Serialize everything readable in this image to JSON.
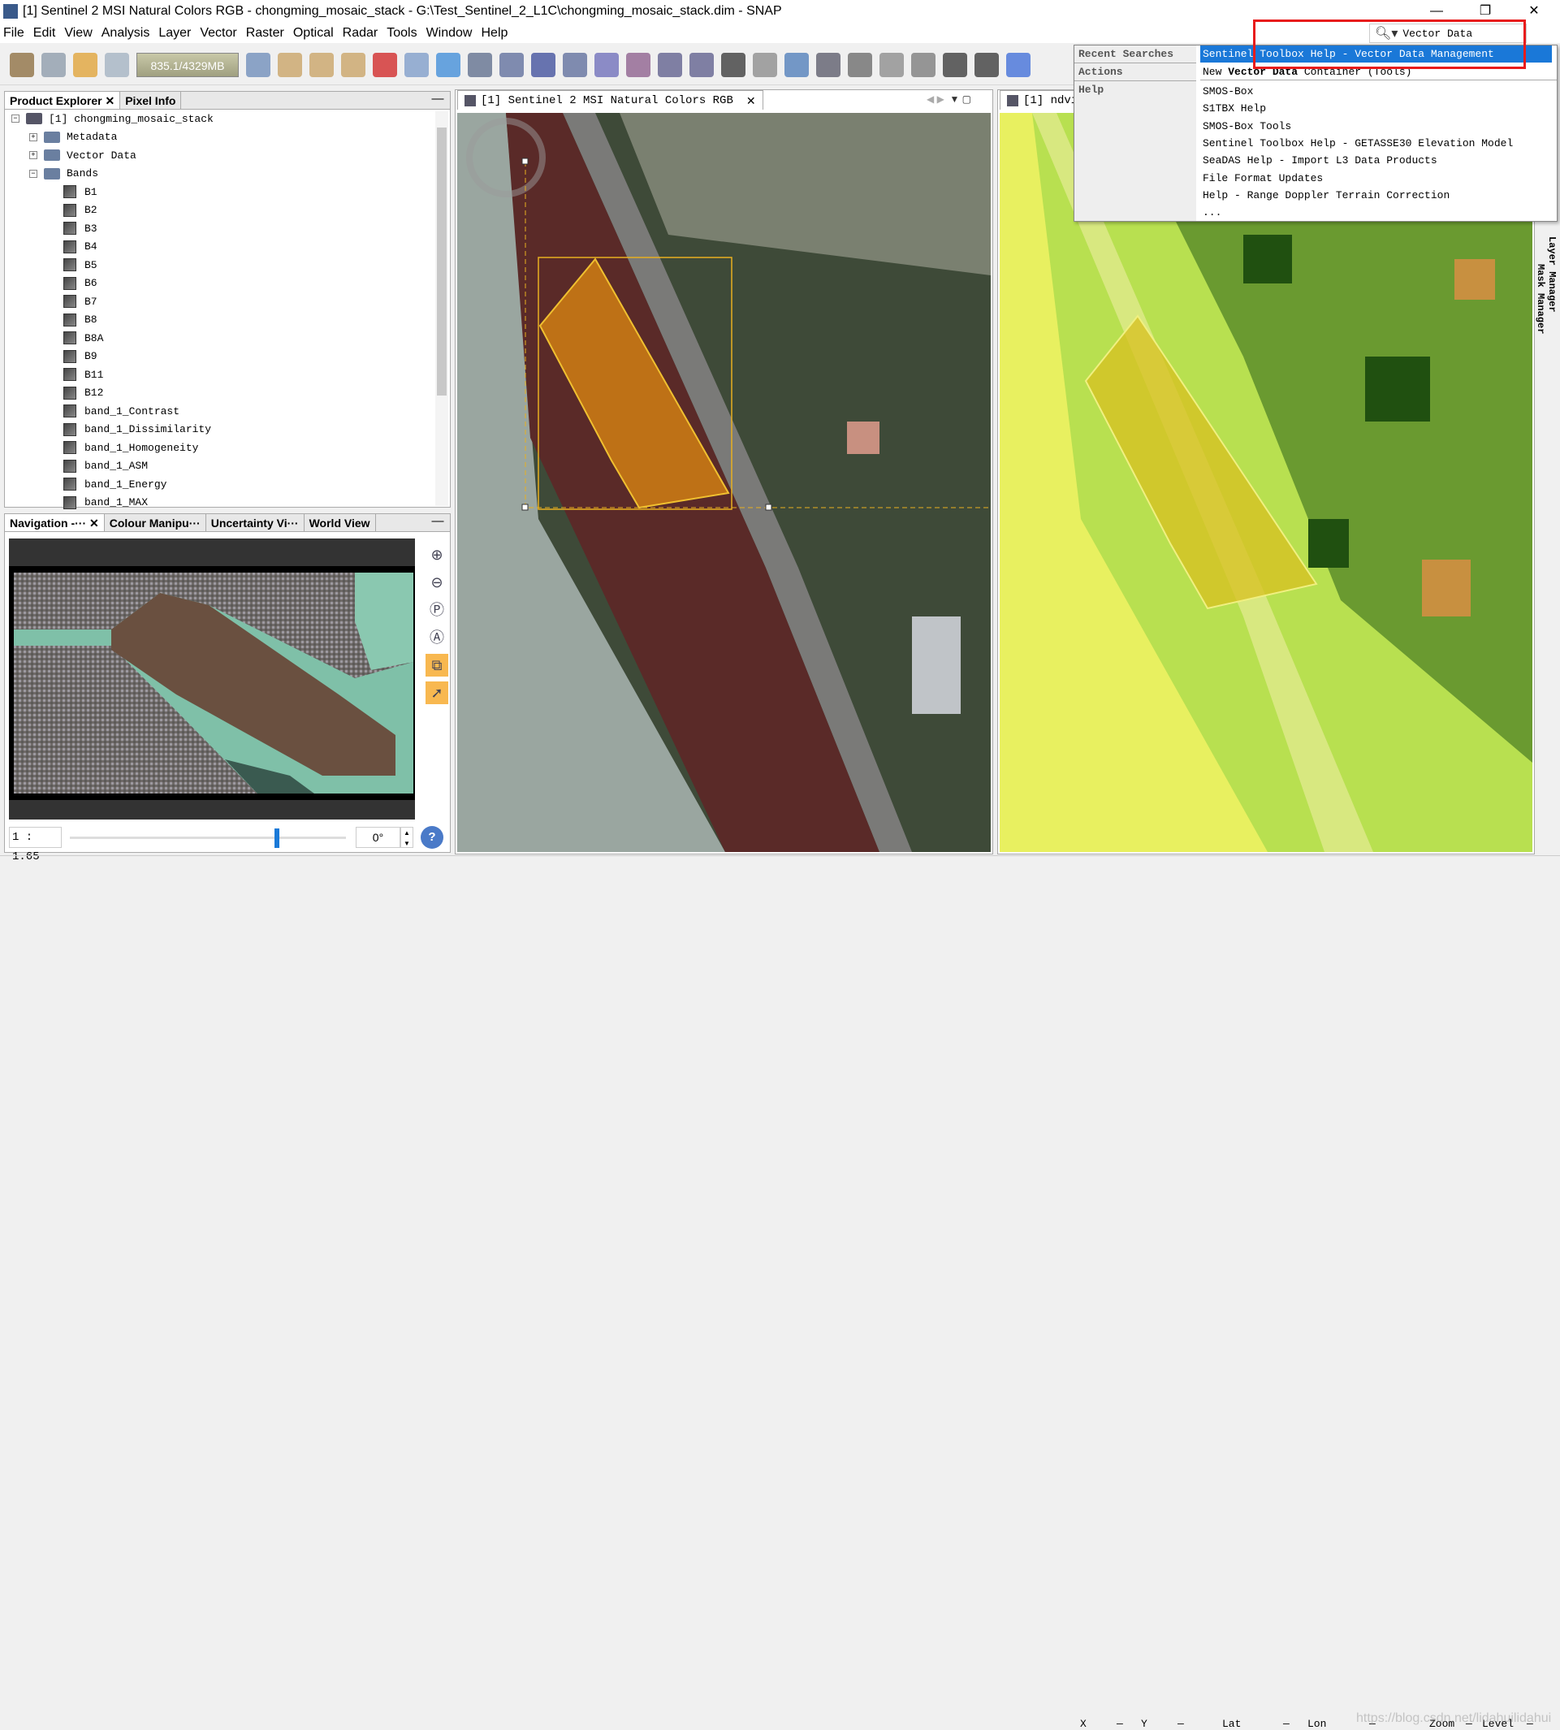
{
  "window": {
    "title": "[1] Sentinel 2 MSI Natural Colors RGB - chongming_mosaic_stack - G:\\Test_Sentinel_2_L1C\\chongming_mosaic_stack.dim - SNAP",
    "minimize": "—",
    "restore": "❐",
    "close": "✕"
  },
  "menu": [
    "File",
    "Edit",
    "View",
    "Analysis",
    "Layer",
    "Vector",
    "Raster",
    "Optical",
    "Radar",
    "Tools",
    "Window",
    "Help"
  ],
  "toolbar": {
    "memory": "835.1/4329MB",
    "icons": [
      "open-product-icon",
      "save-product-icon",
      "undo-icon",
      "redo-icon",
      "memory-gauge",
      "session-icon",
      "import-icon",
      "import-vector-icon",
      "export-icon",
      "rgb-image-icon",
      "tile-windows-icon",
      "wave-icon",
      "spectrum-icon",
      "draw-line-icon",
      "band-maths-icon",
      "histogram-icon",
      "info-icon",
      "statistics-icon",
      "profile-plot-icon",
      "scatter-plot-icon",
      "sum-icon",
      "pin-icon",
      "overlay-icon",
      "graticule-icon",
      "placemark-icon",
      "gcp-icon",
      "world-map-icon",
      "graph-builder-icon",
      "batch-icon",
      "screen-icon"
    ],
    "colors": [
      "#8a6a3a",
      "#8a98a8",
      "#e0a030",
      "#a0b0c0",
      "",
      "#6a8ab8",
      "#c8a060",
      "#c8a060",
      "#c8a060",
      "#d02020",
      "#7a9ac8",
      "#3a8ad8",
      "#5a6a8a",
      "#5a6a9a",
      "#3a4a9a",
      "#5a6a9a",
      "#6a6ab8",
      "#8a5a8a",
      "#5a5a8a",
      "#5a5a8a",
      "#333",
      "#888",
      "#4a7ab8",
      "#556",
      "#666",
      "#888",
      "#777",
      "#333",
      "#333",
      "#3a6ad8"
    ]
  },
  "search": {
    "value": "Vector Data",
    "highlight_color": "#e81c1c",
    "categories": {
      "recent": "Recent Searches",
      "actions": "Actions",
      "help": "Help"
    },
    "recent": [
      "Sentinel Toolbox Help - Vector Data Management"
    ],
    "actions": [
      {
        "pre": "New ",
        "bold": "Vector Data",
        "post": " Container (Tools)"
      }
    ],
    "help": [
      "SMOS-Box",
      "S1TBX Help",
      "SMOS-Box Tools",
      "Sentinel Toolbox Help - GETASSE30 Elevation Model",
      "SeaDAS Help - Import L3 Data Products",
      "File Format Updates",
      "Help - Range Doppler Terrain Correction",
      "..."
    ]
  },
  "product_panel": {
    "tabs": [
      "Product Explorer",
      "Pixel Info"
    ],
    "product": "[1] chongming_mosaic_stack",
    "folders": [
      "Metadata",
      "Vector Data",
      "Bands"
    ],
    "bands": [
      "B1",
      "B2",
      "B3",
      "B4",
      "B5",
      "B6",
      "B7",
      "B8",
      "B8A",
      "B9",
      "B11",
      "B12",
      "band_1_Contrast",
      "band_1_Dissimilarity",
      "band_1_Homogeneity",
      "band_1_ASM",
      "band_1_Energy",
      "band_1_MAX"
    ]
  },
  "nav_panel": {
    "tabs": [
      "Navigation -···",
      "Colour Manipu···",
      "Uncertainty Vi···",
      "World View"
    ],
    "scale": "1 : 1.65",
    "rotation": "0°",
    "zoom_slider": 0.75
  },
  "views": [
    {
      "title": "[1] Sentinel 2 MSI Natural Colors RGB"
    },
    {
      "title": "[1] ndvi"
    }
  ],
  "side": {
    "layer_manager": "Layer Manager",
    "mask_manager": "Mask Manager"
  },
  "status": {
    "x": "X",
    "y": "Y",
    "lat": "Lat",
    "lon": "Lon",
    "zoom": "Zoom",
    "level": "Level",
    "dash": "—",
    "watermark": "https://blog.csdn.net/lidahuilidahui"
  }
}
